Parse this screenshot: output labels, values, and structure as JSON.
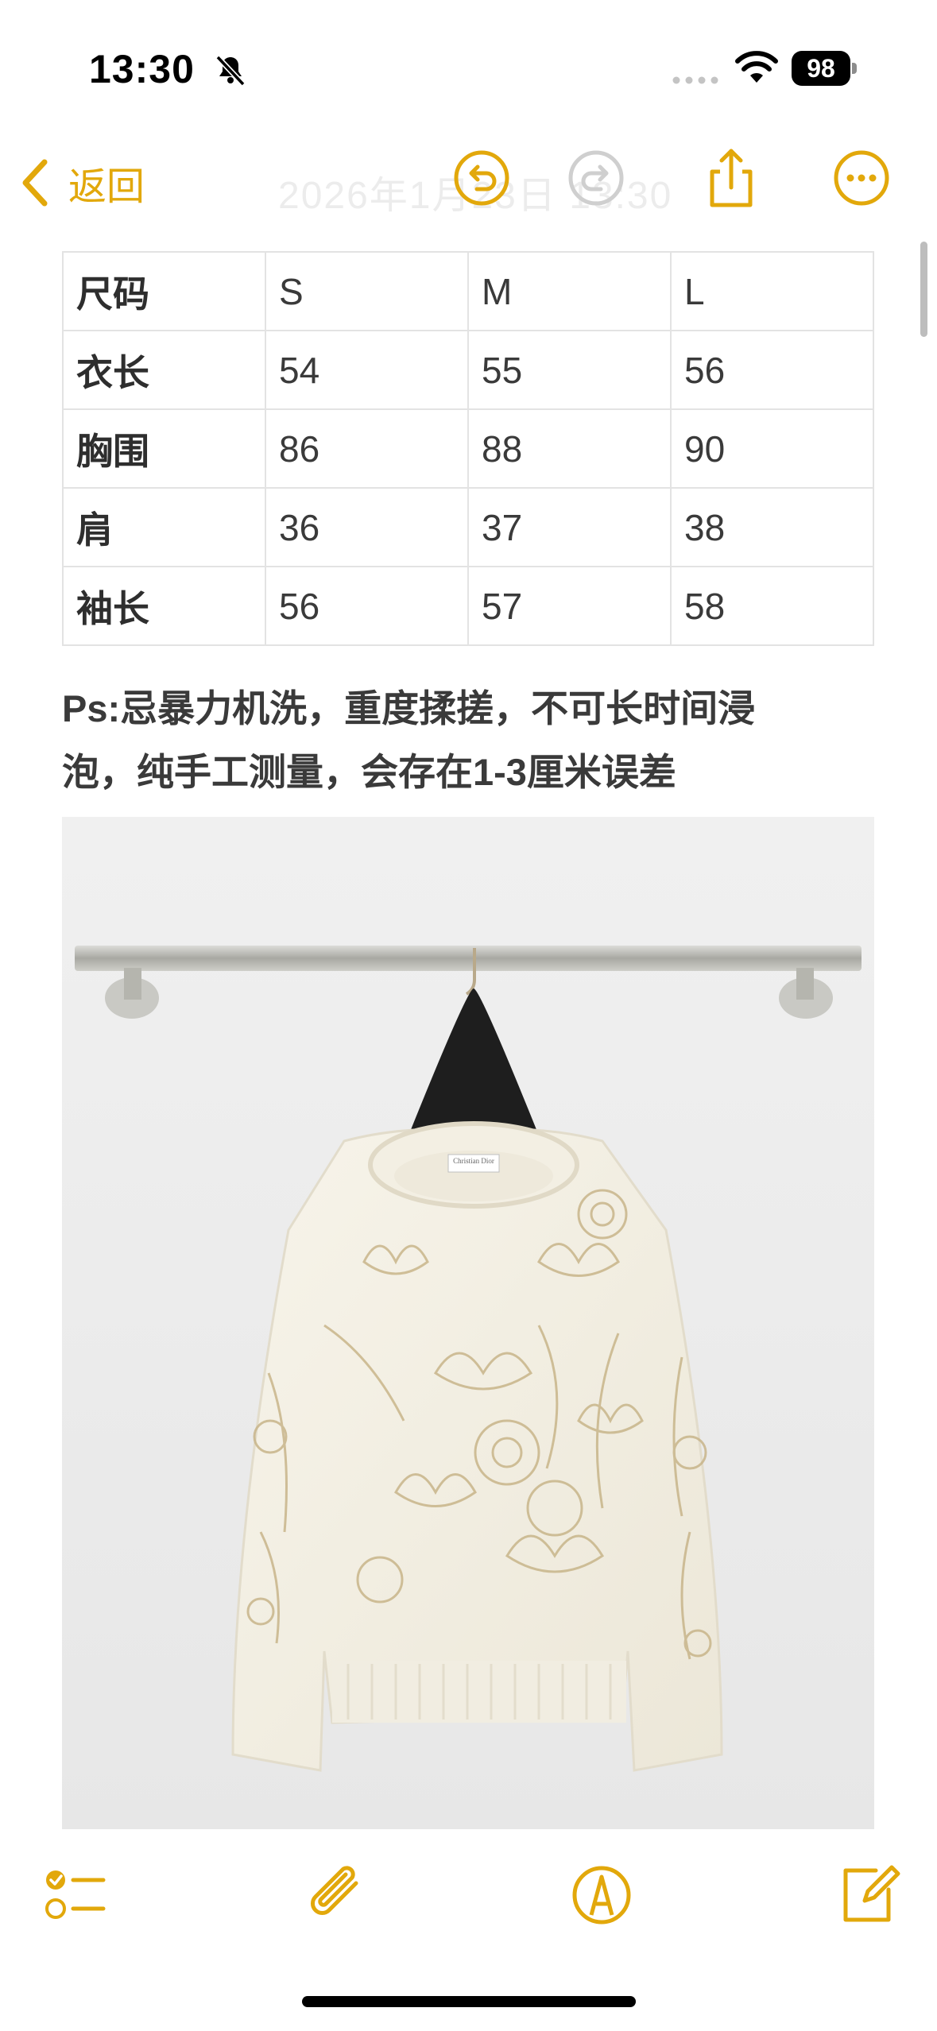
{
  "status_bar": {
    "time": "13:30",
    "battery": "98"
  },
  "nav": {
    "back_label": "返回",
    "title": "2026年1月23日 13:30"
  },
  "size_table": {
    "rows": [
      [
        "尺码",
        "S",
        "M",
        "L"
      ],
      [
        "衣长",
        "54",
        "55",
        "56"
      ],
      [
        "胸围",
        "86",
        "88",
        "90"
      ],
      [
        "肩",
        "36",
        "37",
        "38"
      ],
      [
        "袖长",
        "56",
        "57",
        "58"
      ]
    ]
  },
  "note": {
    "line1": "Ps:忌暴力机洗，重度揉搓，不可长时间浸",
    "line2": "泡，纯手工测量，会存在1-3厘米误差"
  },
  "photo": {
    "label_text": "Christian Dior"
  },
  "toolbar": {
    "icons": [
      "checklist-icon",
      "attachment-icon",
      "markup-icon",
      "compose-icon"
    ]
  },
  "colors": {
    "accent": "#e2a80b",
    "text": "#3a3a3a",
    "grid": "#e3e3e3"
  }
}
